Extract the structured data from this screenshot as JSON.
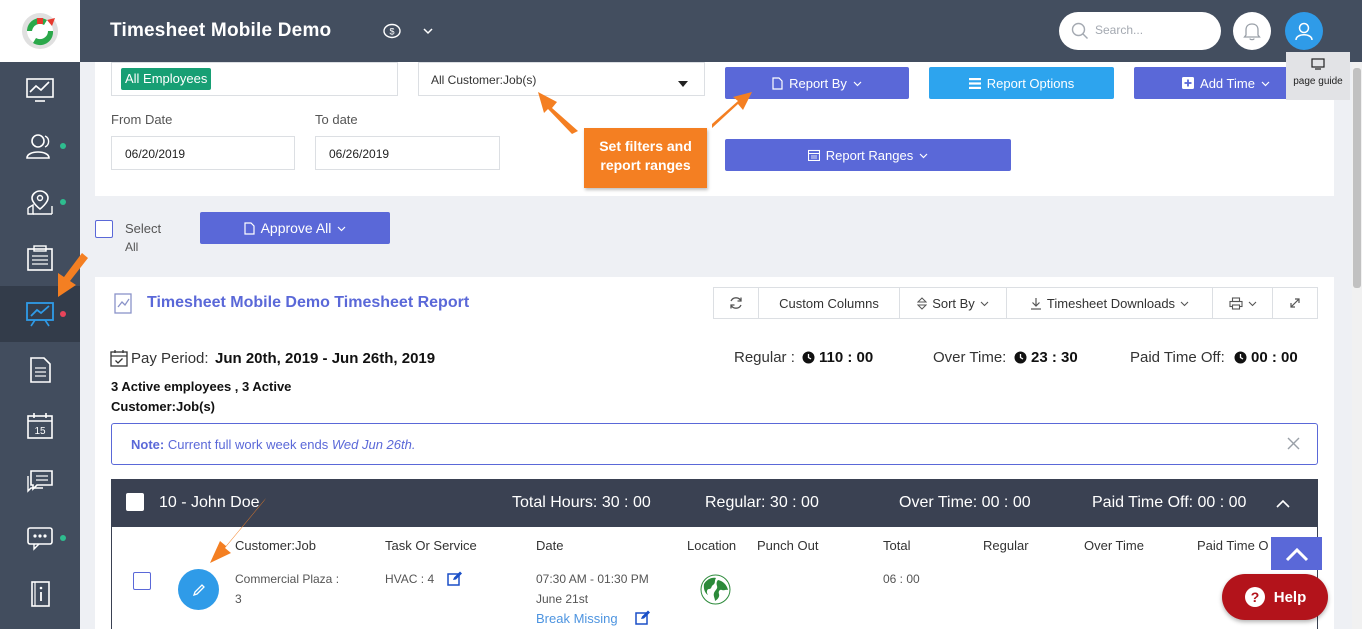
{
  "header": {
    "title": "Timesheet Mobile Demo",
    "search_placeholder": "Search...",
    "page_guide": "page guide"
  },
  "filters": {
    "employee_tag": "All Employees",
    "customer_select": "All Customer:Job(s)",
    "from_label": "From Date",
    "from_value": "06/20/2019",
    "to_label": "To date",
    "to_value": "06/26/2019",
    "report_by": "Report By",
    "report_options": "Report Options",
    "add_time": "Add Time",
    "report_ranges": "Report Ranges"
  },
  "callout": {
    "line1": "Set filters and",
    "line2": "report ranges"
  },
  "actions": {
    "select_all_line1": "Select",
    "select_all_line2": "All",
    "approve_all": "Approve All"
  },
  "report": {
    "title": "Timesheet Mobile Demo Timesheet Report",
    "toolbar": {
      "custom_columns": "Custom Columns",
      "sort_by": "Sort By",
      "downloads": "Timesheet Downloads"
    },
    "pay_period_label": "Pay Period:",
    "pay_period_value": "Jun 20th, 2019 - Jun 26th, 2019",
    "regular_label": "Regular :",
    "regular_value": "110 : 00",
    "overtime_label": "Over Time:",
    "overtime_value": "23 : 30",
    "pto_label": "Paid Time Off:",
    "pto_value": "00 : 00",
    "active_line1": "3 Active employees , 3 Active",
    "active_line2": "Customer:Job(s)",
    "note_bold": "Note:",
    "note_text": "Current full work week ends",
    "note_date": "Wed Jun 26th."
  },
  "employee": {
    "name": "10 - John Doe",
    "total_hours": "Total Hours: 30 : 00",
    "regular": "Regular: 30 : 00",
    "overtime": "Over Time: 00 : 00",
    "pto": "Paid Time Off: 00 : 00"
  },
  "table": {
    "columns": [
      "Customer:Job",
      "Task Or Service",
      "Date",
      "Location",
      "Punch Out",
      "Total",
      "Regular",
      "Over Time",
      "Paid Time O"
    ],
    "row": {
      "customer_line1": "Commercial Plaza :",
      "customer_line2": "3",
      "task": "HVAC : 4",
      "time": "07:30 AM - 01:30 PM",
      "date": "June 21st",
      "break_missing": "Break Missing",
      "total": "06 : 00"
    }
  },
  "help": {
    "label": "Help"
  },
  "colors": {
    "sidebar": "#424d5e",
    "header": "#434e5f",
    "primary": "#5a68d8",
    "cyan": "#2da4ee",
    "accent_orange": "#f47f22",
    "help_red": "#b3131b",
    "tag_green": "#179f74"
  }
}
